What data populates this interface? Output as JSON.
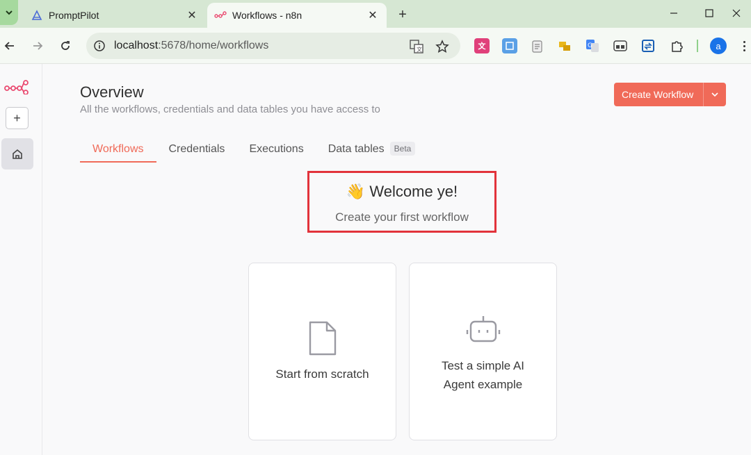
{
  "browser": {
    "tabs": [
      {
        "title": "PromptPilot",
        "active": false,
        "icon": "promptpilot-icon"
      },
      {
        "title": "Workflows - n8n",
        "active": true,
        "icon": "n8n-icon"
      }
    ],
    "url": {
      "host": "localhost",
      "path": ":5678/home/workflows"
    },
    "profile_initial": "a"
  },
  "page": {
    "title": "Overview",
    "subtitle": "All the workflows, credentials and data tables you have access to",
    "create_button": "Create Workflow"
  },
  "tabs": [
    {
      "label": "Workflows",
      "active": true
    },
    {
      "label": "Credentials",
      "active": false
    },
    {
      "label": "Executions",
      "active": false
    },
    {
      "label": "Data tables",
      "active": false,
      "badge": "Beta"
    }
  ],
  "welcome": {
    "emoji": "👋",
    "title": "Welcome ye!",
    "subtitle": "Create your first workflow"
  },
  "cards": [
    {
      "label": "Start from scratch",
      "icon": "file-icon"
    },
    {
      "label_line1": "Test a simple AI",
      "label_line2": "Agent example",
      "icon": "robot-icon"
    }
  ],
  "colors": {
    "accent": "#f06a58",
    "highlight_border": "#e2333b",
    "tabstrip": "#d6e7d3"
  }
}
